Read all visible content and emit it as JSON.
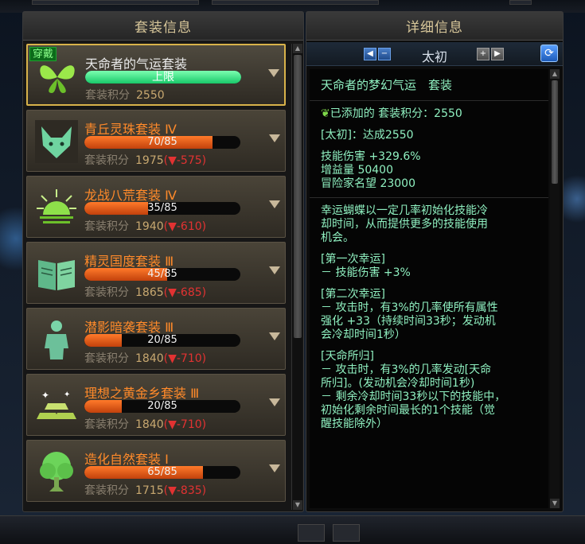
{
  "left_panel": {
    "title": "套装信息"
  },
  "wearing_badge": "穿戴",
  "sets": [
    {
      "name": "天命者的气运套装",
      "name_color": "#e8e8e8",
      "progress_text": "上限",
      "fill": 1.0,
      "full": true,
      "score_label": "套装积分",
      "score": "2550",
      "delta": "",
      "icon": "butterfly-icon"
    },
    {
      "name": "青丘灵珠套装 Ⅳ",
      "name_color": "#ff8a2a",
      "progress_text": "70/85",
      "fill": 0.82,
      "full": false,
      "score_label": "套装积分",
      "score": "1975",
      "delta": "(▼-575)",
      "icon": "fox-icon"
    },
    {
      "name": "龙战八荒套装 Ⅳ",
      "name_color": "#ff8a2a",
      "progress_text": "35/85",
      "fill": 0.41,
      "full": false,
      "score_label": "套装积分",
      "score": "1940",
      "delta": "(▼-610)",
      "icon": "sunrise-icon"
    },
    {
      "name": "精灵国度套装 Ⅲ",
      "name_color": "#ff8a2a",
      "progress_text": "45/85",
      "fill": 0.53,
      "full": false,
      "score_label": "套装积分",
      "score": "1865",
      "delta": "(▼-685)",
      "icon": "book-icon"
    },
    {
      "name": "潜影暗袭套装 Ⅲ",
      "name_color": "#ff8a2a",
      "progress_text": "20/85",
      "fill": 0.24,
      "full": false,
      "score_label": "套装积分",
      "score": "1840",
      "delta": "(▼-710)",
      "icon": "body-icon"
    },
    {
      "name": "理想之黄金乡套装 Ⅲ",
      "name_color": "#ff8a2a",
      "progress_text": "20/85",
      "fill": 0.24,
      "full": false,
      "score_label": "套装积分",
      "score": "1840",
      "delta": "(▼-710)",
      "icon": "gold-bars-icon"
    },
    {
      "name": "造化自然套装 Ⅰ",
      "name_color": "#ff8a2a",
      "progress_text": "65/85",
      "fill": 0.76,
      "full": false,
      "score_label": "套装积分",
      "score": "1715",
      "delta": "(▼-835)",
      "icon": "tree-icon"
    }
  ],
  "right_panel": {
    "title": "详细信息",
    "tier": "太初",
    "detail_title": "天命者的梦幻气运　套装",
    "added_label": "已添加的 套装积分：2550",
    "tier_achieved": "[太初]：达成2550",
    "stats": [
      "技能伤害 +329.6%",
      "增益量 50400",
      "冒险家名望 23000"
    ],
    "desc": [
      "幸运蝴蝶以一定几率初始化技能冷",
      "却时间，从而提供更多的技能使用",
      "机会。"
    ],
    "luck1_title": "[第一次幸运]",
    "luck1_line": "－ 技能伤害 +3%",
    "luck2_title": "[第二次幸运]",
    "luck2_lines": [
      "－ 攻击时，有3%的几率使所有属性",
      "强化 +33（持续时间33秒；发动机",
      "会冷却时间1秒）"
    ],
    "fate_title": "[天命所归]",
    "fate_lines": [
      "－ 攻击时，有3%的几率发动[天命",
      "所归]。(发动机会冷却时间1秒)",
      "－ 剩余冷却时间33秒以下的技能中，",
      "初始化剩余时间最长的1个技能（觉",
      "醒技能除外）"
    ]
  },
  "colors": {
    "accent_gold": "#d8b24a",
    "text_mint": "#8ff0c0",
    "bar_orange": "#ff7a2a",
    "bar_green": "#19c86a",
    "delta_red": "#e23232"
  }
}
